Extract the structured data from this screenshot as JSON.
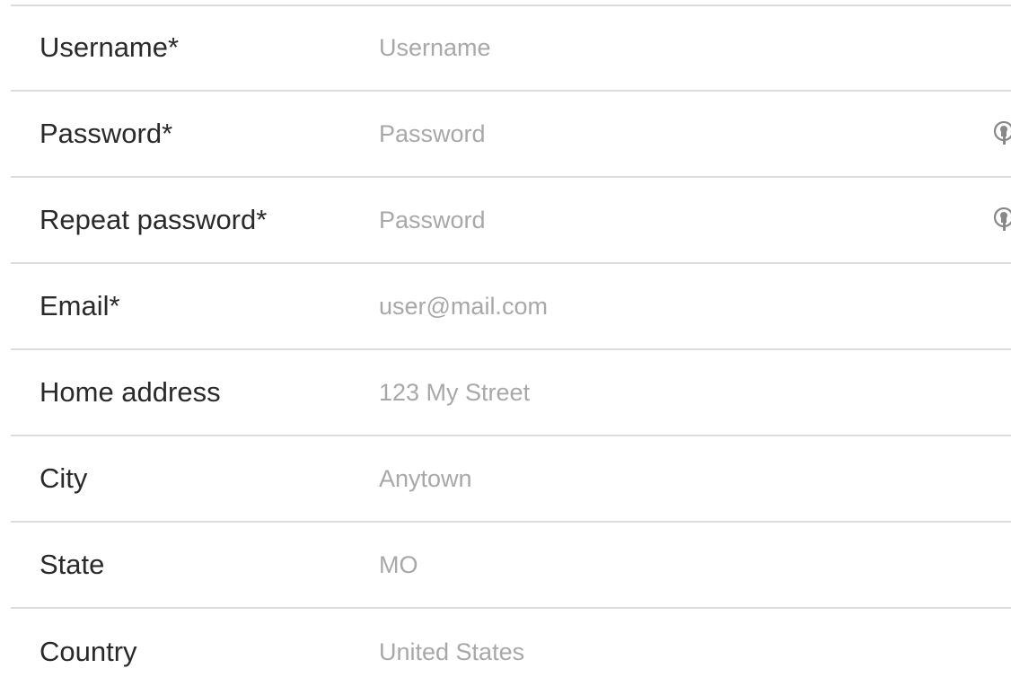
{
  "form": {
    "fields": [
      {
        "label": "Username*",
        "placeholder": "Username",
        "type": "text"
      },
      {
        "label": "Password*",
        "placeholder": "Password",
        "type": "password",
        "icon": "password-key-icon"
      },
      {
        "label": "Repeat password*",
        "placeholder": "Password",
        "type": "password",
        "icon": "password-key-icon"
      },
      {
        "label": "Email*",
        "placeholder": "user@mail.com",
        "type": "email"
      },
      {
        "label": "Home address",
        "placeholder": "123 My Street",
        "type": "text"
      },
      {
        "label": "City",
        "placeholder": "Anytown",
        "type": "text"
      },
      {
        "label": "State",
        "placeholder": "MO",
        "type": "text"
      },
      {
        "label": "Country",
        "placeholder": "United States",
        "type": "text"
      }
    ]
  }
}
